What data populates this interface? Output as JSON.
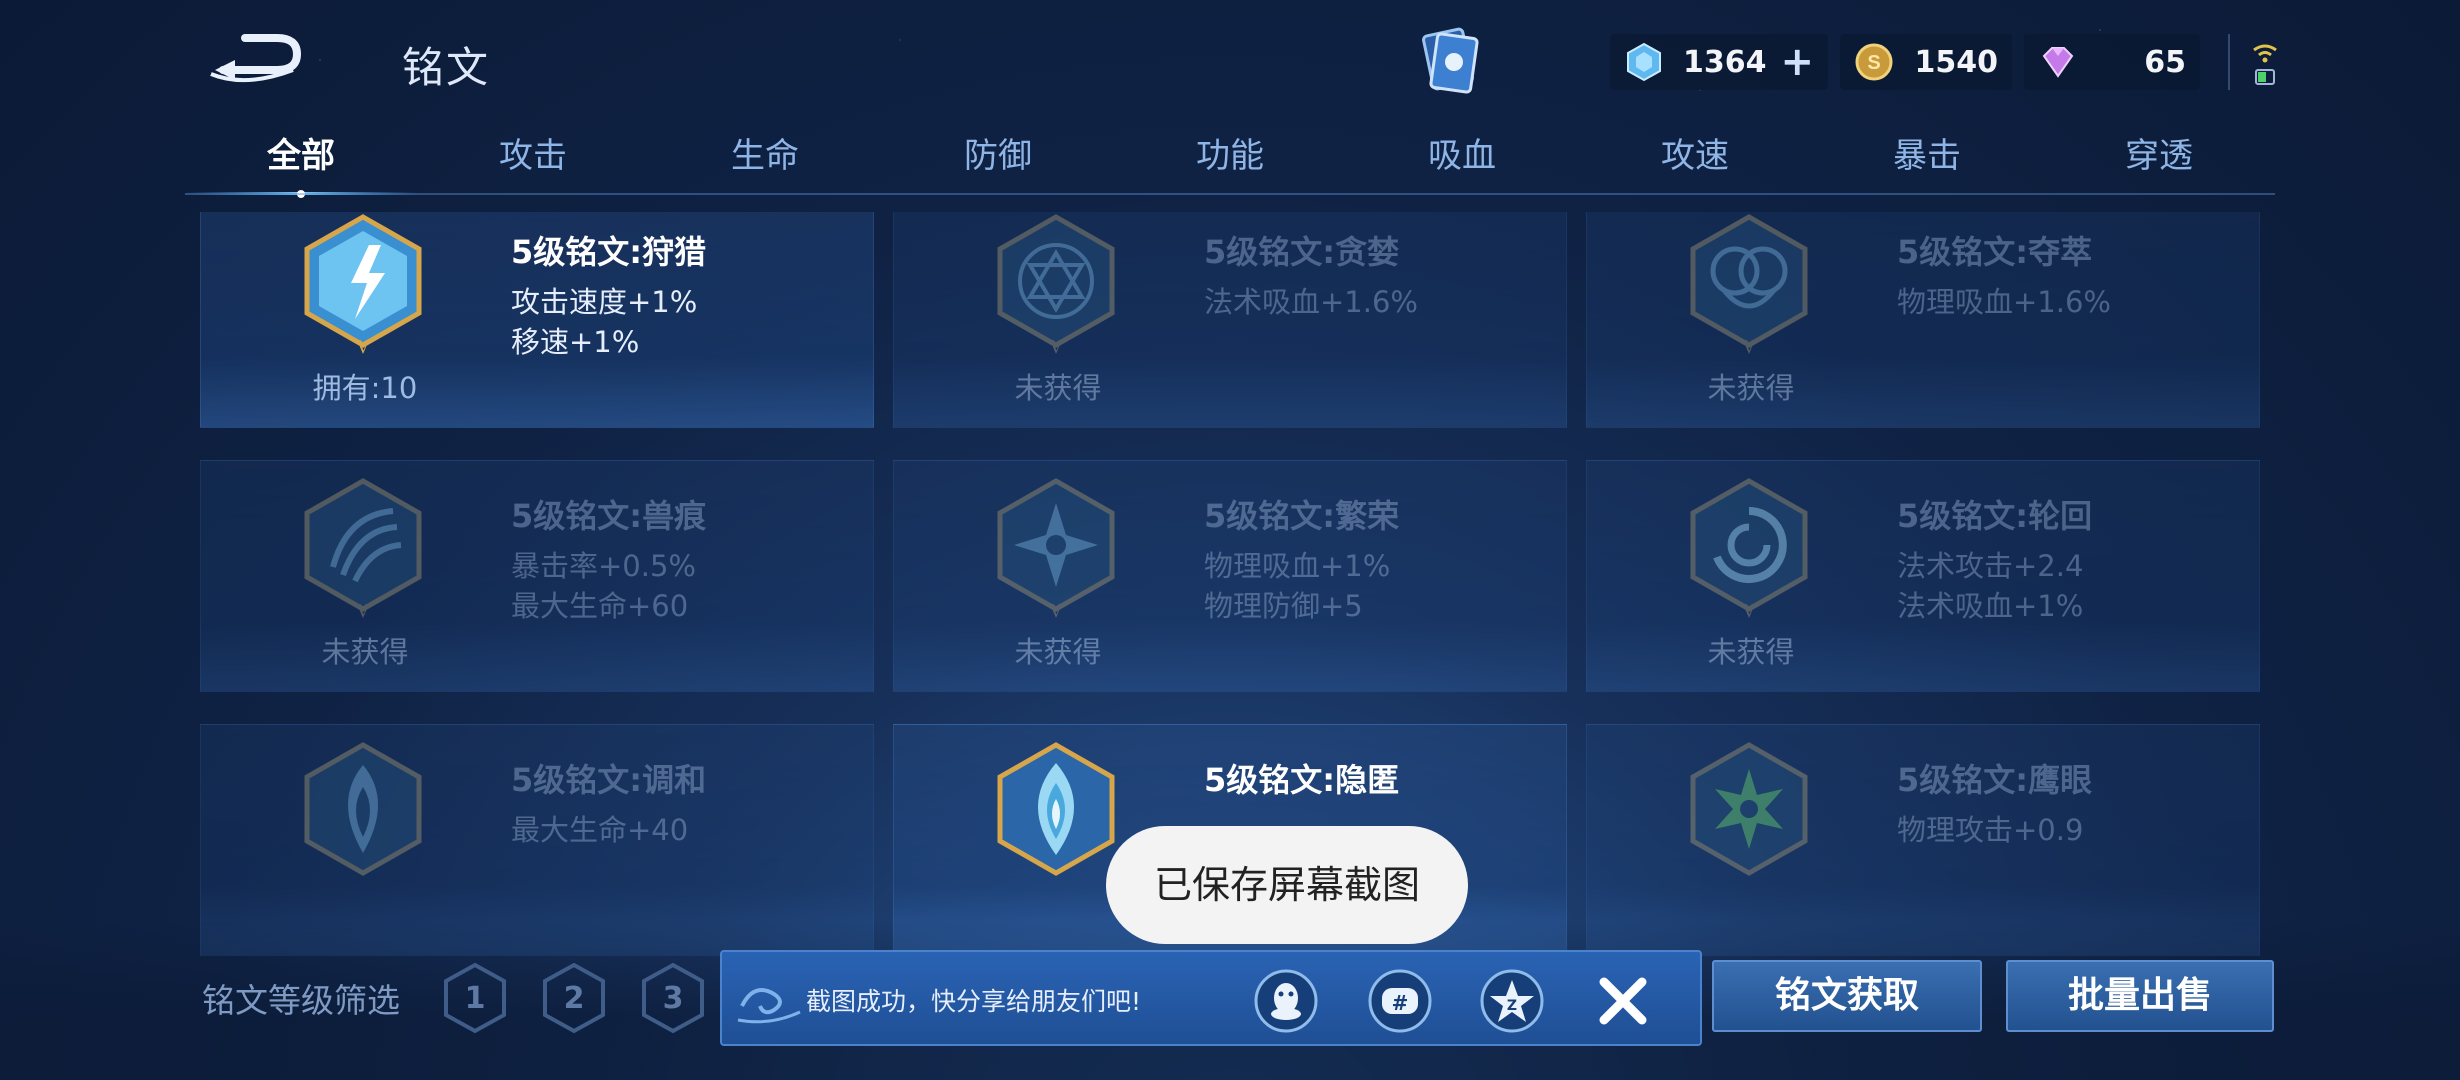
{
  "header": {
    "title": "铭文",
    "resources": [
      {
        "icon": "blue-crystal-icon",
        "value": "1364"
      },
      {
        "icon": "gold-coin-icon",
        "value": "1540"
      },
      {
        "icon": "purple-diamond-icon",
        "value": "65"
      }
    ]
  },
  "tabs": [
    {
      "label": "全部",
      "active": true
    },
    {
      "label": "攻击"
    },
    {
      "label": "生命"
    },
    {
      "label": "防御"
    },
    {
      "label": "功能"
    },
    {
      "label": "吸血"
    },
    {
      "label": "攻速"
    },
    {
      "label": "暴击"
    },
    {
      "label": "穿透"
    }
  ],
  "inscriptions": [
    {
      "name": "5级铭文:狩猎",
      "stats": [
        "攻击速度+1%",
        "移速+1%"
      ],
      "owned": "拥有:10",
      "acquired": true
    },
    {
      "name": "5级铭文:贪婪",
      "stats": [
        "法术吸血+1.6%",
        ""
      ],
      "owned": "未获得",
      "acquired": false
    },
    {
      "name": "5级铭文:夺萃",
      "stats": [
        "物理吸血+1.6%",
        ""
      ],
      "owned": "未获得",
      "acquired": false
    },
    {
      "name": "5级铭文:兽痕",
      "stats": [
        "暴击率+0.5%",
        "最大生命+60"
      ],
      "owned": "未获得",
      "acquired": false
    },
    {
      "name": "5级铭文:繁荣",
      "stats": [
        "物理吸血+1%",
        "物理防御+5"
      ],
      "owned": "未获得",
      "acquired": false
    },
    {
      "name": "5级铭文:轮回",
      "stats": [
        "法术攻击+2.4",
        "法术吸血+1%"
      ],
      "owned": "未获得",
      "acquired": false
    },
    {
      "name": "5级铭文:调和",
      "stats": [
        "最大生命+40",
        ""
      ],
      "owned": "",
      "acquired": false
    },
    {
      "name": "5级铭文:隐匿",
      "stats": [
        "",
        ""
      ],
      "owned": "",
      "acquired": true
    },
    {
      "name": "5级铭文:鹰眼",
      "stats": [
        "物理攻击+0.9",
        ""
      ],
      "owned": "",
      "acquired": false
    }
  ],
  "filter": {
    "label": "铭文等级筛选",
    "levels": [
      "1",
      "2",
      "3"
    ]
  },
  "buttons": {
    "get": "铭文获取",
    "sell": "批量出售"
  },
  "share": {
    "message": "截图成功，快分享给朋友们吧!"
  },
  "toast": "已保存屏幕截图"
}
